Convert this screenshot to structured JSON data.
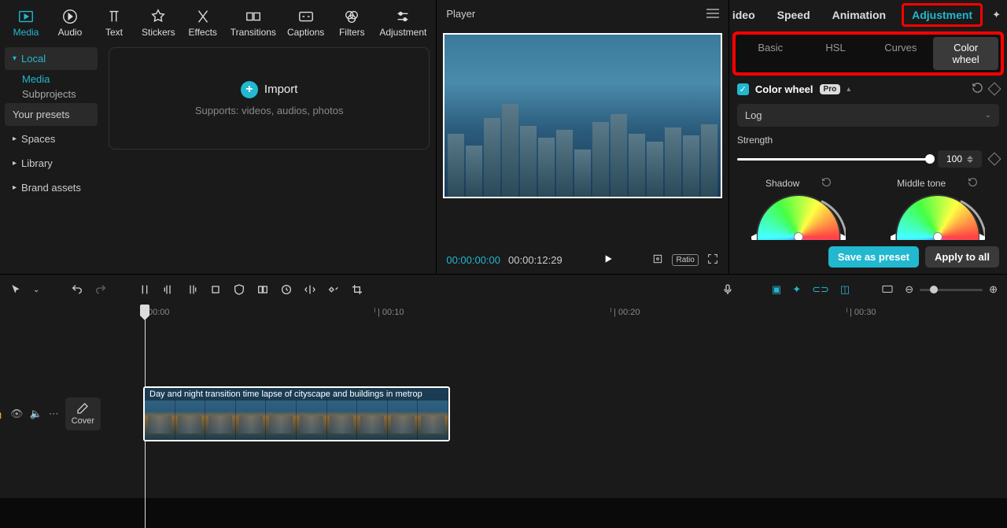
{
  "topTabs": {
    "media": "Media",
    "audio": "Audio",
    "text": "Text",
    "stickers": "Stickers",
    "effects": "Effects",
    "transitions": "Transitions",
    "captions": "Captions",
    "filters": "Filters",
    "adjustment": "Adjustment"
  },
  "sidebar": {
    "local": "Local",
    "localItems": {
      "media": "Media",
      "subprojects": "Subprojects",
      "presets": "Your presets"
    },
    "spaces": "Spaces",
    "library": "Library",
    "brand": "Brand assets"
  },
  "import": {
    "title": "Import",
    "sub": "Supports: videos, audios, photos"
  },
  "player": {
    "title": "Player",
    "current": "00:00:00:00",
    "duration": "00:00:12:29",
    "ratioLabel": "Ratio"
  },
  "rightTabs": {
    "video": "ideo",
    "speed": "Speed",
    "animation": "Animation",
    "adjustment": "Adjustment"
  },
  "subTabs": {
    "basic": "Basic",
    "hsl": "HSL",
    "curves": "Curves",
    "colorwheel": "Color wheel"
  },
  "colorWheel": {
    "title": "Color wheel",
    "pro": "Pro",
    "mode": "Log",
    "strengthLabel": "Strength",
    "strengthValue": "100",
    "shadow": "Shadow",
    "midtone": "Middle tone"
  },
  "footer": {
    "save": "Save as preset",
    "apply": "Apply to all"
  },
  "timeline": {
    "ticks": [
      "00:00",
      "| 00:10",
      "| 00:20",
      "| 00:30"
    ],
    "cover": "Cover",
    "clipTitle": "Day and night transition time lapse of cityscape and buildings in metrop"
  }
}
